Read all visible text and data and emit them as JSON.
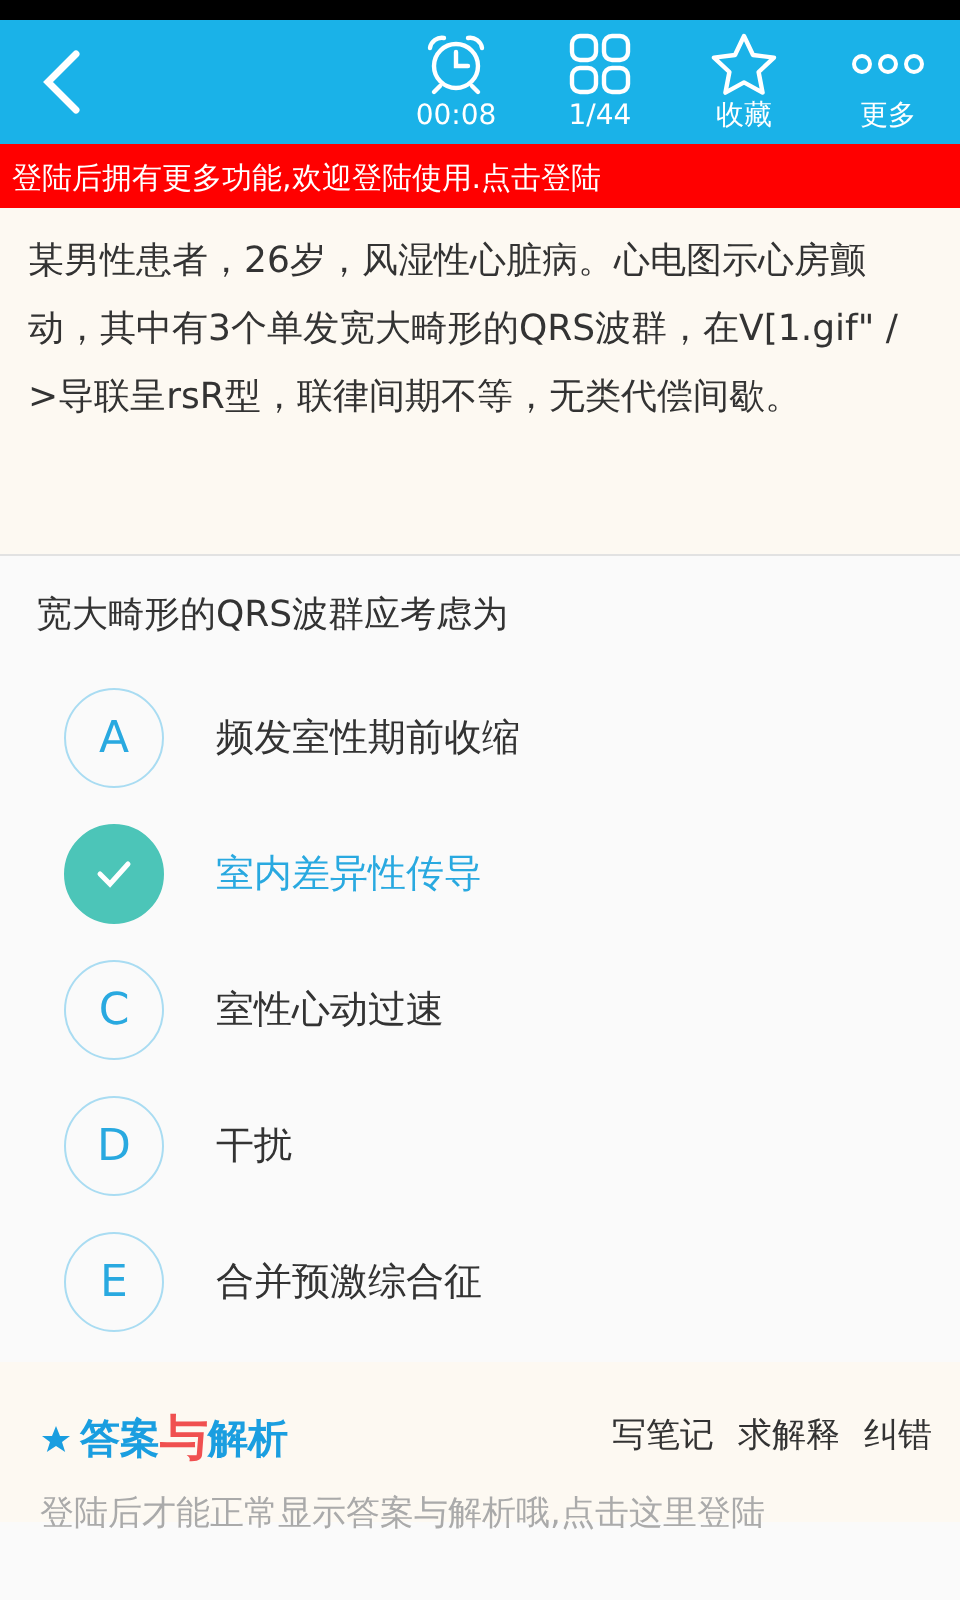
{
  "header": {
    "timer": "00:08",
    "progress": "1/44",
    "favorite": "收藏",
    "more": "更多"
  },
  "login_banner": "登陆后拥有更多功能,欢迎登陆使用.点击登陆",
  "case_text": "某男性患者，26岁，风湿性心脏病。心电图示心房颤动，其中有3个单发宽大畸形的QRS波群，在V[1.gif\" />导联呈rsR型，联律间期不等，无类代偿间歇。",
  "question": "宽大畸形的QRS波群应考虑为",
  "options": [
    {
      "letter": "A",
      "text": "频发室性期前收缩",
      "selected": false
    },
    {
      "text": "室内差异性传导",
      "selected": true
    },
    {
      "letter": "C",
      "text": "室性心动过速",
      "selected": false
    },
    {
      "letter": "D",
      "text": "干扰",
      "selected": false
    },
    {
      "letter": "E",
      "text": "合并预激综合征",
      "selected": false
    }
  ],
  "answer_section": {
    "title_start": "答案",
    "title_joiner": "与",
    "title_end": "解析",
    "actions": [
      "写笔记",
      "求解释",
      "纠错"
    ],
    "notice": "登陆后才能正常显示答案与解析哦,点击这里登陆"
  }
}
